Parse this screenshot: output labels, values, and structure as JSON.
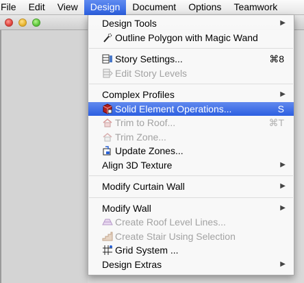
{
  "menubar": {
    "items": [
      "File",
      "Edit",
      "View",
      "Design",
      "Document",
      "Options",
      "Teamwork"
    ]
  },
  "menu": {
    "design_tools": {
      "label": "Design Tools"
    },
    "outline_polygon": {
      "label": "Outline Polygon with Magic Wand"
    },
    "story_settings": {
      "label": "Story Settings...",
      "shortcut": "⌘8"
    },
    "edit_story_levels": {
      "label": "Edit Story Levels"
    },
    "complex_profiles": {
      "label": "Complex Profiles"
    },
    "solid_element_operations": {
      "label": "Solid Element Operations...",
      "shortcut": "S"
    },
    "trim_to_roof": {
      "label": "Trim to Roof...",
      "shortcut": "⌘T"
    },
    "trim_zone": {
      "label": "Trim Zone..."
    },
    "update_zones": {
      "label": "Update Zones..."
    },
    "align_3d_texture": {
      "label": "Align 3D Texture"
    },
    "modify_curtain_wall": {
      "label": "Modify Curtain Wall"
    },
    "modify_wall": {
      "label": "Modify Wall"
    },
    "create_roof_level_lines": {
      "label": "Create Roof Level Lines..."
    },
    "create_stair_using_selection": {
      "label": "Create Stair Using Selection"
    },
    "grid_system": {
      "label": "Grid System ..."
    },
    "design_extras": {
      "label": "Design Extras"
    },
    "submenu_arrow": "▶"
  },
  "colors": {
    "highlight": "#2c5fe1",
    "disabled_text": "#a2a2a2"
  }
}
